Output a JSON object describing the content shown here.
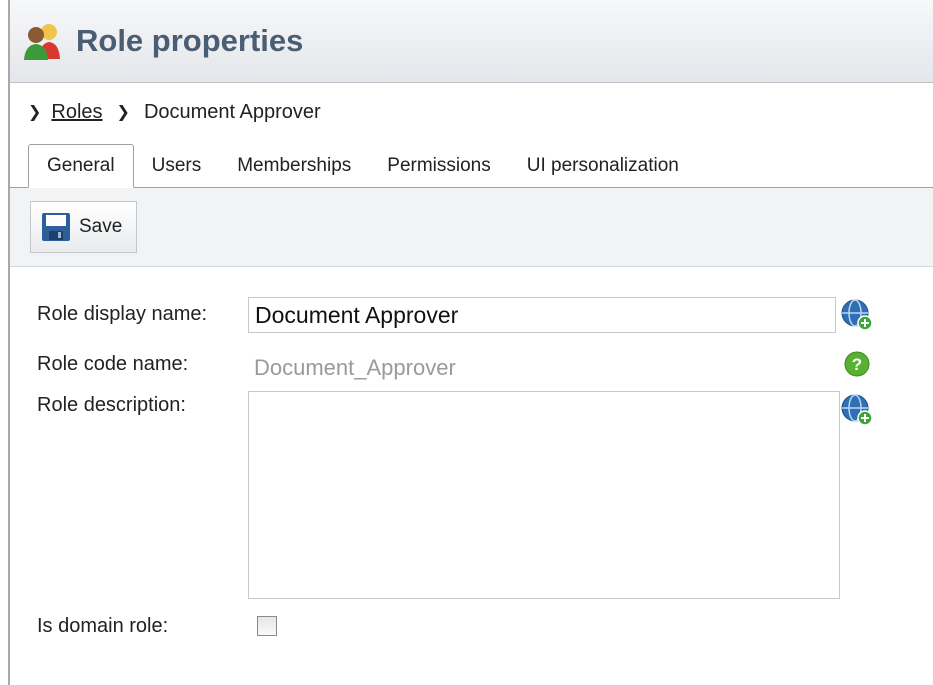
{
  "header": {
    "title": "Role properties",
    "icon": "users-icon"
  },
  "breadcrumb": {
    "root_label": "Roles",
    "current_label": "Document Approver"
  },
  "tabs": [
    {
      "label": "General",
      "active": true
    },
    {
      "label": "Users",
      "active": false
    },
    {
      "label": "Memberships",
      "active": false
    },
    {
      "label": "Permissions",
      "active": false
    },
    {
      "label": "UI personalization",
      "active": false
    }
  ],
  "toolbar": {
    "save_label": "Save"
  },
  "form": {
    "display_name_label": "Role display name:",
    "display_name_value": "Document Approver",
    "code_name_label": "Role code name:",
    "code_name_value": "Document_Approver",
    "description_label": "Role description:",
    "description_value": "",
    "domain_role_label": "Is domain role:",
    "domain_role_checked": false
  },
  "colors": {
    "title": "#4a5d73",
    "help_green": "#59b031",
    "globe_blue": "#2f6fb6"
  }
}
